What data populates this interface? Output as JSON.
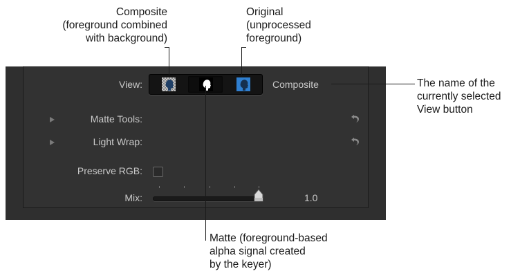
{
  "annotations": {
    "composite": [
      "Composite",
      "(foreground combined",
      "with background)"
    ],
    "original": [
      "Original",
      "(unprocessed",
      "foreground)"
    ],
    "view_name": [
      "The name of the",
      "currently selected",
      "View button"
    ],
    "matte": [
      "Matte (foreground-based",
      "alpha signal created",
      "by the keyer)"
    ]
  },
  "inspector": {
    "view": {
      "label": "View:",
      "buttons": [
        {
          "name": "Composite",
          "icon": "composite-head-icon",
          "selected": false
        },
        {
          "name": "Matte",
          "icon": "matte-head-icon",
          "selected": true
        },
        {
          "name": "Original",
          "icon": "original-head-icon",
          "selected": false
        }
      ],
      "current_name": "Composite"
    },
    "matte_tools": {
      "label": "Matte Tools:"
    },
    "light_wrap": {
      "label": "Light Wrap:"
    },
    "preserve_rgb": {
      "label": "Preserve RGB:",
      "checked": false
    },
    "mix": {
      "label": "Mix:",
      "value": "1.0",
      "fraction": 1.0
    }
  },
  "colors": {
    "panel_bg": "#323232",
    "label_text": "#c9c9c9",
    "original_blue": "#2f7fd0",
    "callout_text": "#1a1a1a"
  }
}
